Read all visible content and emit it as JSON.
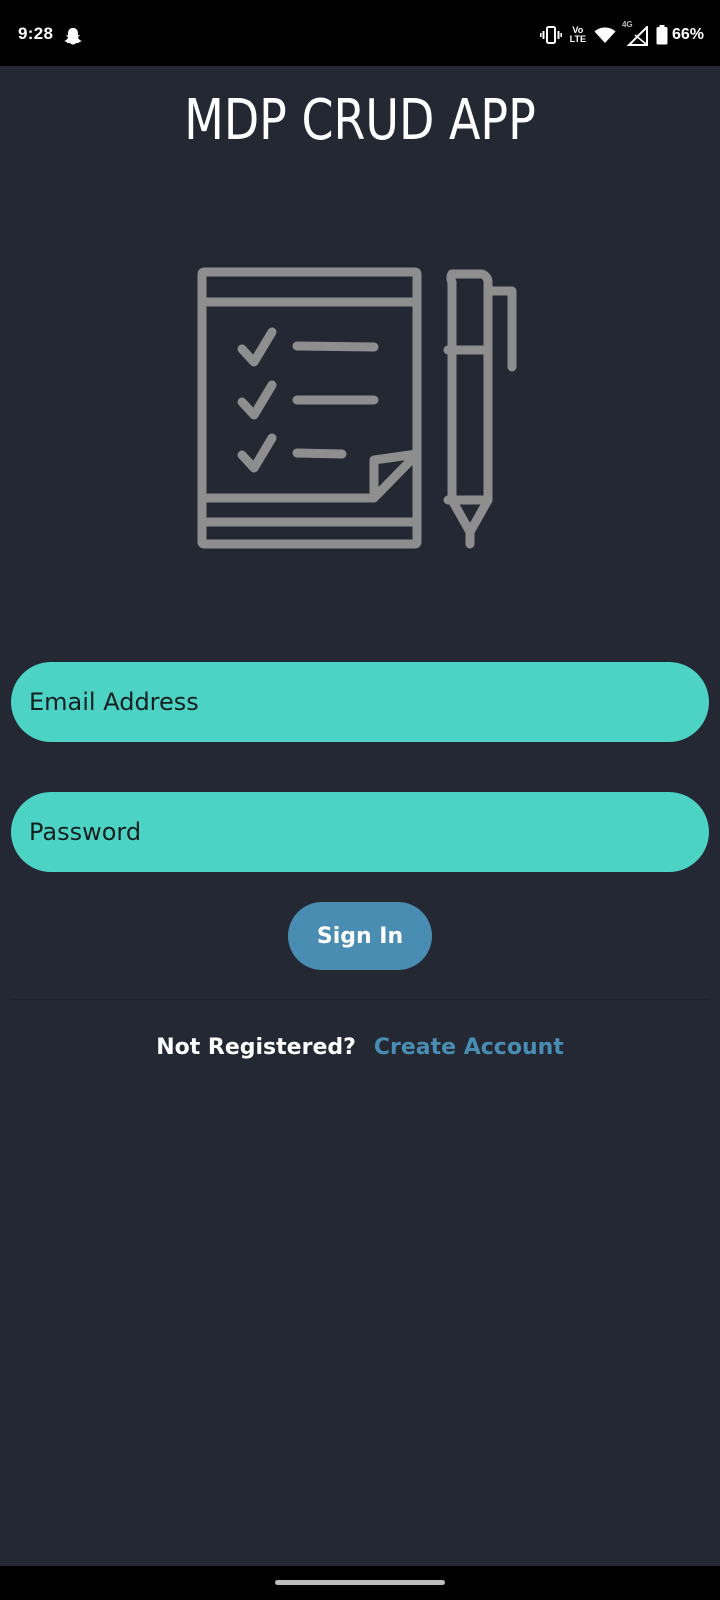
{
  "status_bar": {
    "time": "9:28",
    "volte_top": "Vo",
    "volte_bottom": "LTE",
    "network": "4G",
    "battery": "66%"
  },
  "app": {
    "title": "MDP CRUD APP"
  },
  "login_form": {
    "email_placeholder": "Email Address",
    "password_placeholder": "Password",
    "signin_label": "Sign In"
  },
  "register": {
    "prompt": "Not Registered?",
    "link_label": "Create Account"
  },
  "colors": {
    "background": "#232833",
    "input_fill": "#4dd3c5",
    "button_fill": "#4a8db2",
    "link": "#4a8db2",
    "illustration": "#8e8e8e"
  },
  "icons": [
    "snapchat-icon",
    "vibrate-icon",
    "wifi-icon",
    "signal-icon",
    "battery-icon",
    "checklist-illustration",
    "pen-illustration"
  ]
}
